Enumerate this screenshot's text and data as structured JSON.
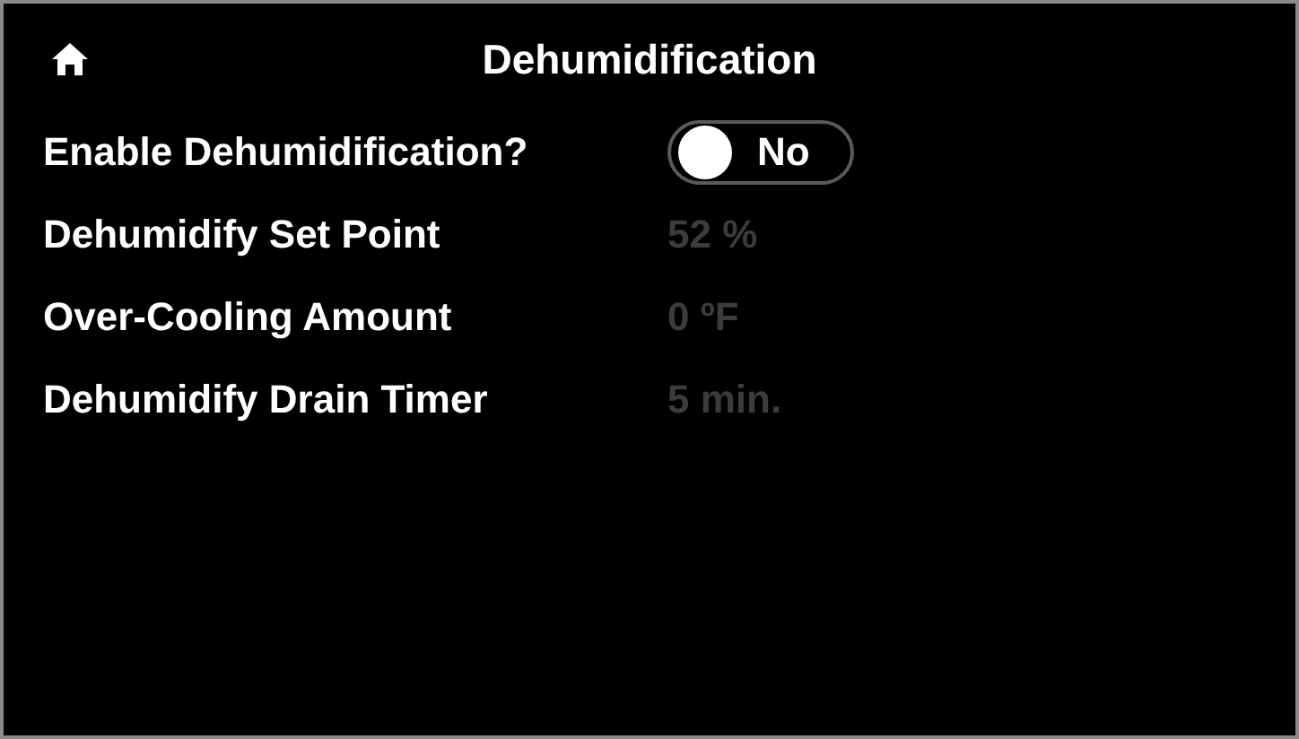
{
  "header": {
    "title": "Dehumidification"
  },
  "settings": [
    {
      "kind": "toggle",
      "label": "Enable Dehumidification?",
      "on": false,
      "value": "No"
    },
    {
      "kind": "value",
      "label": "Dehumidify Set Point",
      "value": "52 %",
      "disabled": true
    },
    {
      "kind": "value",
      "label": "Over-Cooling Amount",
      "value": "0 ºF",
      "disabled": true
    },
    {
      "kind": "value",
      "label": "Dehumidify Drain Timer",
      "value": "5 min.",
      "disabled": true
    }
  ]
}
